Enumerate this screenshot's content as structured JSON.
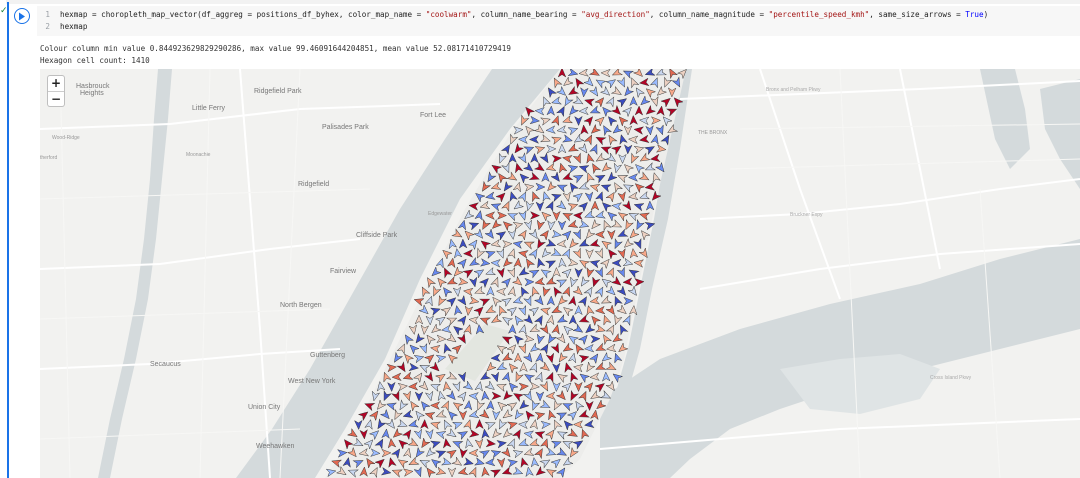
{
  "cell": {
    "status_glyph": "✓",
    "lines": [
      {
        "num": "1"
      },
      {
        "num": "2",
        "text": "hexmap"
      }
    ],
    "code1": {
      "p1": "hexmap = choropleth_map_vector(df_aggreg = positions_df_byhex, color_map_name = ",
      "s1": "\"coolwarm\"",
      "p2": ", column_name_bearing = ",
      "s2": "\"avg_direction\"",
      "p3": ", column_name_magnitude = ",
      "s3": "\"percentile_speed_kmh\"",
      "p4": ", same_size_arrows = ",
      "k1": "True",
      "p5": ")"
    }
  },
  "output": {
    "line1": "Colour column min value 0.844923629829290286, max value 99.46091644204851, mean value 52.08171410729419",
    "line2": "Hexagon cell count: 1410"
  },
  "map": {
    "zoom_in": "+",
    "zoom_out": "−",
    "labels": {
      "hasbrouck": "Hasbrouck",
      "heights": "Heights",
      "little_ferry": "Little Ferry",
      "ridgefield_park": "Ridgefield Park",
      "palisades_park": "Palisades Park",
      "fort_lee": "Fort Lee",
      "wood_ridge": "Wood-Ridge",
      "moonachie": "Moonachie",
      "rutherford": "therford",
      "ridgefield": "Ridgefield",
      "edgewater": "Edgewater",
      "cliffside_park": "Cliffside Park",
      "fairview": "Fairview",
      "north_bergen": "North Bergen",
      "guttenberg": "Guttenberg",
      "secaucus": "Secaucus",
      "west_new_york": "West New York",
      "union_city": "Union City",
      "weehawken": "Weehawken",
      "the_bronx": "THE BRONX",
      "bruckner": "Bruckner Expy",
      "cross_island": "Cross Island Pkwy",
      "bronx_pelham": "Bronx and Pelham Pkwy"
    },
    "arrow_colors": [
      "#3b4cc0",
      "#6788ee",
      "#9abbff",
      "#c9d7f0",
      "#edd1c2",
      "#f7a889",
      "#e26952",
      "#b40426"
    ]
  }
}
